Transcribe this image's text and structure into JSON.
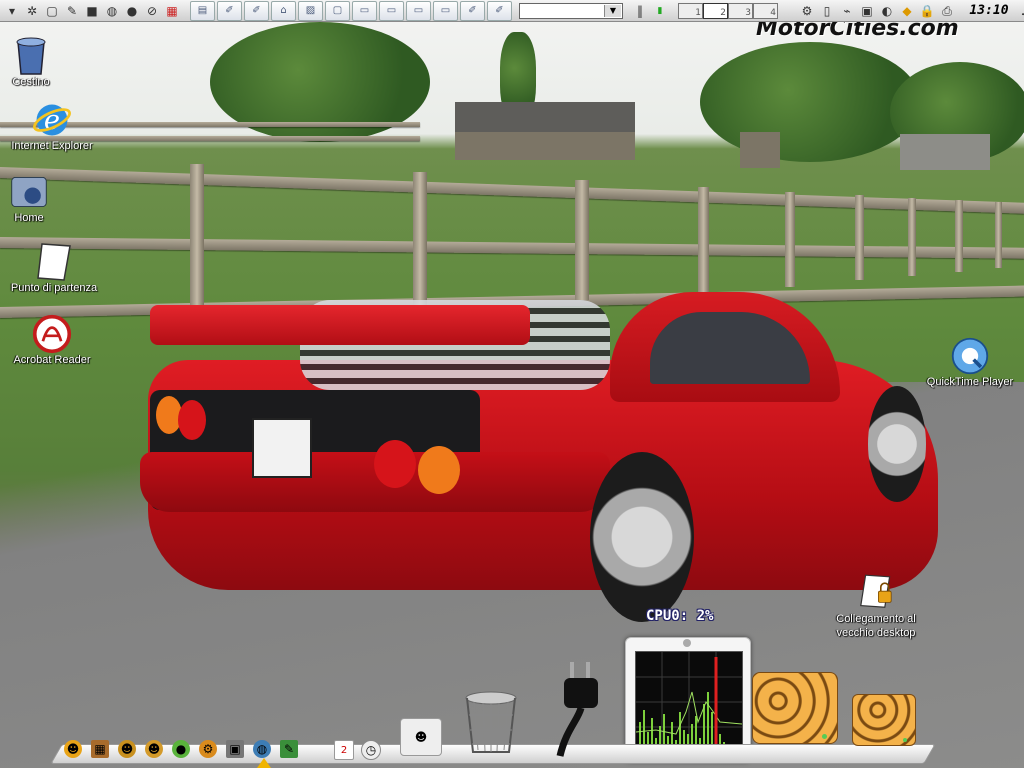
{
  "top_panel": {
    "clock": "13:10",
    "combo_value": "",
    "desktops": [
      "1",
      "2",
      "3",
      "4"
    ],
    "active_desktop": 1,
    "task_count": 12
  },
  "watermark": "MotorCities.com",
  "desktop_icons": [
    {
      "label": "Cestino",
      "icon": "trash-bin-icon"
    },
    {
      "label": "Internet Explorer",
      "icon": "internet-explorer-icon"
    },
    {
      "label": "Home",
      "icon": "home-folder-icon"
    },
    {
      "label": "Punto di partenza",
      "icon": "document-icon"
    },
    {
      "label": "Acrobat Reader",
      "icon": "acrobat-reader-icon"
    },
    {
      "label": "QuickTime Player",
      "icon": "quicktime-icon"
    },
    {
      "label": "Collegamento al vecchio desktop",
      "icon": "locked-document-icon"
    }
  ],
  "cpu_monitor": {
    "label": "CPU0: 2%",
    "usage_percent": 2
  },
  "colors": {
    "panel_bg": "#dcdcdc",
    "cpu_graph_green": "#7dd03c",
    "cpu_graph_red": "#e02020",
    "icon_label": "#ffffff"
  }
}
